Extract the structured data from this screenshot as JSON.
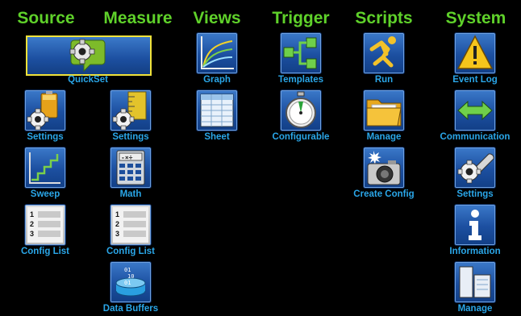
{
  "headers": {
    "source": "Source",
    "measure": "Measure",
    "views": "Views",
    "trigger": "Trigger",
    "scripts": "Scripts",
    "system": "System"
  },
  "source": {
    "quickset": "QuickSet",
    "settings": "Settings",
    "sweep": "Sweep",
    "config_list": "Config List"
  },
  "measure": {
    "settings": "Settings",
    "math": "Math",
    "config_list": "Config List",
    "data_buffers": "Data Buffers"
  },
  "views": {
    "graph": "Graph",
    "sheet": "Sheet"
  },
  "trigger": {
    "templates": "Templates",
    "configurable": "Configurable"
  },
  "scripts": {
    "run": "Run",
    "manage": "Manage",
    "create_config": "Create Config"
  },
  "system": {
    "event_log": "Event Log",
    "communication": "Communication",
    "settings": "Settings",
    "information": "Information",
    "manage": "Manage"
  },
  "colors": {
    "header": "#5fd12a",
    "label": "#2aa6e8",
    "tile": "#1c4fa0",
    "highlight": "#f0e23a"
  }
}
